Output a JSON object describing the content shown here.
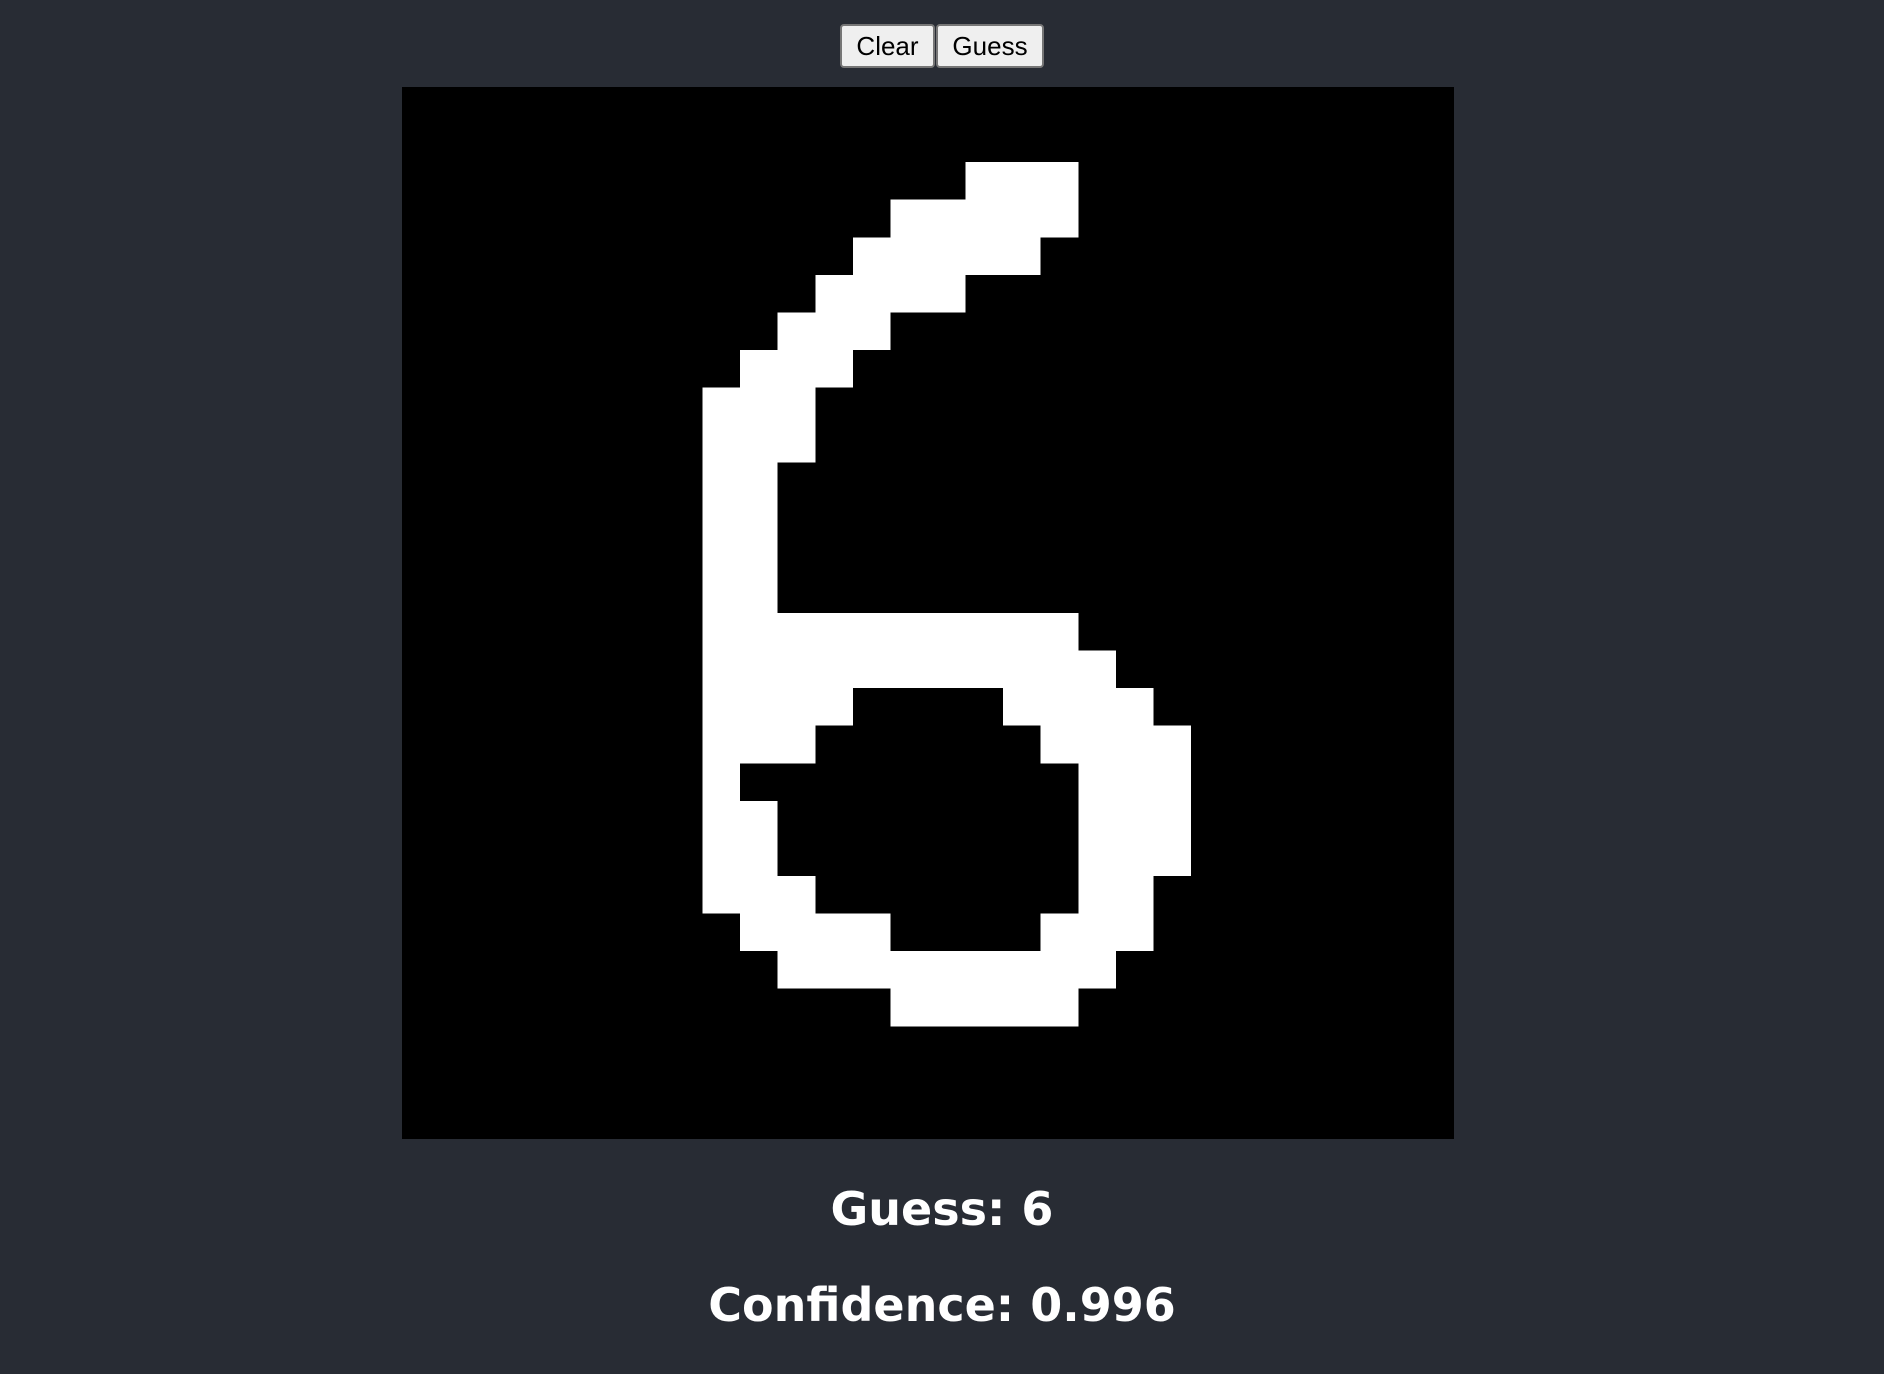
{
  "controls": {
    "clear_label": "Clear",
    "guess_label": "Guess"
  },
  "canvas": {
    "background": "#000000",
    "ink": "#ffffff",
    "grid_size": 28,
    "ink_rows": [
      {
        "row": 2,
        "runs": [
          [
            15,
            17
          ]
        ]
      },
      {
        "row": 3,
        "runs": [
          [
            13,
            17
          ]
        ]
      },
      {
        "row": 4,
        "runs": [
          [
            12,
            16
          ]
        ]
      },
      {
        "row": 5,
        "runs": [
          [
            11,
            14
          ]
        ]
      },
      {
        "row": 6,
        "runs": [
          [
            10,
            12
          ]
        ]
      },
      {
        "row": 7,
        "runs": [
          [
            9,
            11
          ]
        ]
      },
      {
        "row": 8,
        "runs": [
          [
            8,
            10
          ]
        ]
      },
      {
        "row": 9,
        "runs": [
          [
            8,
            10
          ]
        ]
      },
      {
        "row": 10,
        "runs": [
          [
            8,
            9
          ]
        ]
      },
      {
        "row": 11,
        "runs": [
          [
            8,
            9
          ]
        ]
      },
      {
        "row": 12,
        "runs": [
          [
            8,
            9
          ]
        ]
      },
      {
        "row": 13,
        "runs": [
          [
            8,
            9
          ]
        ]
      },
      {
        "row": 14,
        "runs": [
          [
            8,
            17
          ]
        ]
      },
      {
        "row": 15,
        "runs": [
          [
            8,
            18
          ]
        ]
      },
      {
        "row": 16,
        "runs": [
          [
            8,
            11
          ],
          [
            16,
            19
          ]
        ]
      },
      {
        "row": 17,
        "runs": [
          [
            8,
            10
          ],
          [
            17,
            20
          ]
        ]
      },
      {
        "row": 18,
        "runs": [
          [
            8,
            8
          ],
          [
            18,
            20
          ]
        ]
      },
      {
        "row": 19,
        "runs": [
          [
            8,
            9
          ],
          [
            18,
            20
          ]
        ]
      },
      {
        "row": 20,
        "runs": [
          [
            8,
            9
          ],
          [
            18,
            20
          ]
        ]
      },
      {
        "row": 21,
        "runs": [
          [
            8,
            10
          ],
          [
            18,
            19
          ]
        ]
      },
      {
        "row": 22,
        "runs": [
          [
            9,
            12
          ],
          [
            17,
            19
          ]
        ]
      },
      {
        "row": 23,
        "runs": [
          [
            10,
            18
          ]
        ]
      },
      {
        "row": 24,
        "runs": [
          [
            13,
            17
          ]
        ]
      }
    ]
  },
  "result": {
    "guess_text": "Guess: 6",
    "confidence_text": "Confidence: 0.996"
  }
}
